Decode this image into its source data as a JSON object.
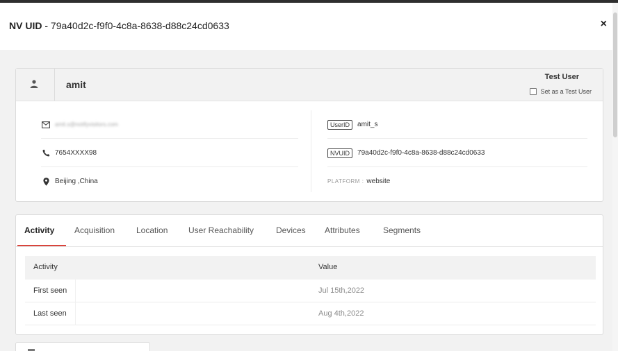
{
  "header": {
    "title_prefix": "NV UID",
    "title_sep": " - ",
    "nv_uid": "79a40d2c-f9f0-4c8a-8638-d88c24cd0633",
    "close_label": "×"
  },
  "profile": {
    "name": "amit",
    "test_user_title": "Test User",
    "test_user_checkbox_label": "Set as a Test User",
    "test_user_checked": false,
    "email": "amit.s@notifyvisitors.com",
    "phone": "7654XXXX98",
    "location": "Beijing ,China",
    "userid_tag": "UserID",
    "userid_value": "amit_s",
    "nvuid_tag": "NVUID",
    "nvuid_value": "79a40d2c-f9f0-4c8a-8638-d88c24cd0633",
    "platform_label": "PLATFORM :",
    "platform_value": "website"
  },
  "tabs": [
    {
      "label": "Activity",
      "active": true
    },
    {
      "label": "Acquisition",
      "active": false
    },
    {
      "label": "Location",
      "active": false
    },
    {
      "label": "User Reachability",
      "active": false
    },
    {
      "label": "Devices",
      "active": false
    },
    {
      "label": "Attributes",
      "active": false
    },
    {
      "label": "Segments",
      "active": false
    }
  ],
  "table": {
    "headers": [
      "Activity",
      "Value"
    ],
    "rows": [
      [
        "First seen",
        "Jul 15th,2022"
      ],
      [
        "Last seen",
        "Aug 4th,2022"
      ]
    ]
  },
  "colors": {
    "accent": "#d9443c",
    "header_bg": "#f2f2f2",
    "text": "#333333"
  },
  "icons": [
    "user-icon",
    "envelope-icon",
    "phone-icon",
    "map-pin-icon",
    "close-icon"
  ]
}
